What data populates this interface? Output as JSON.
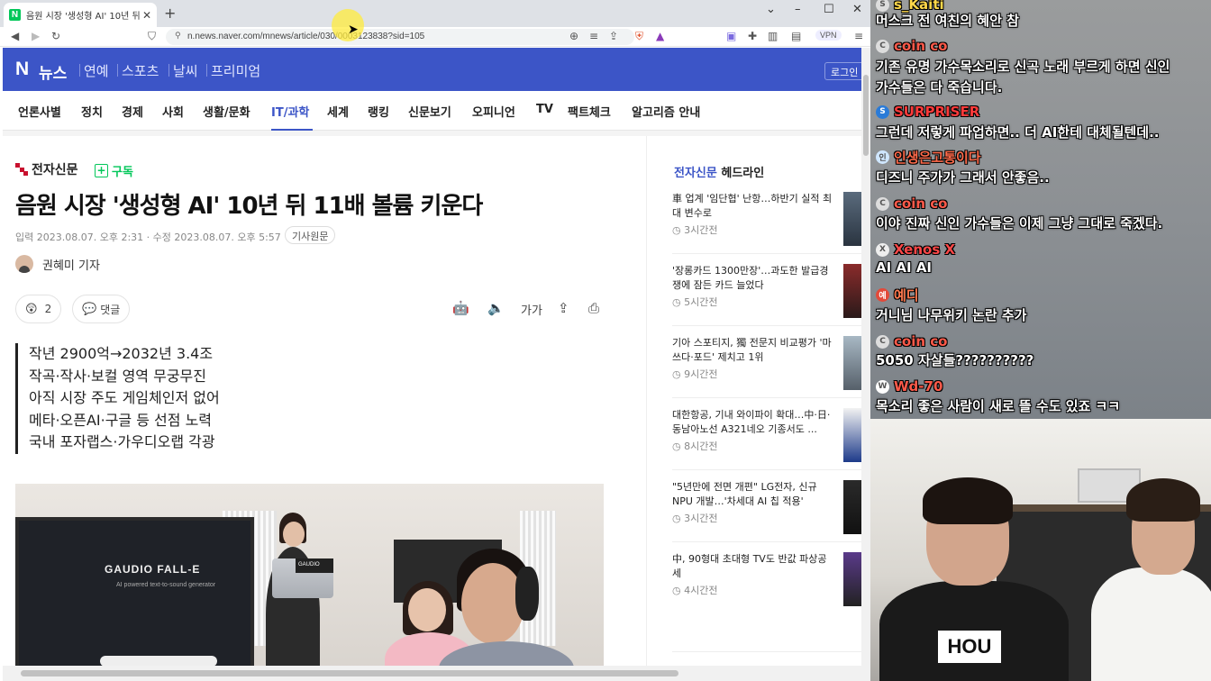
{
  "browser": {
    "tab_title": "음원 시장 '생성형 AI' 10년 뒤 11배 ...",
    "favicon_letter": "N",
    "url": "n.news.naver.com/mnews/article/030/0003123838?sid=105",
    "vpn_label": "VPN"
  },
  "naver": {
    "logo": "N",
    "news": "뉴스",
    "links": [
      "연예",
      "스포츠",
      "날씨",
      "프리미엄"
    ],
    "login": "로그인"
  },
  "menu": [
    "언론사별",
    "정치",
    "경제",
    "사회",
    "생활/문화",
    "IT/과학",
    "세계",
    "랭킹",
    "신문보기",
    "오피니언",
    "TV",
    "팩트체크",
    "알고리즘 안내"
  ],
  "article": {
    "press": "전자신문",
    "subscribe": "구독",
    "title": "음원 시장 '생성형 AI' 10년 뒤 11배 볼륨 키운다",
    "meta": "입력 2023.08.07. 오후 2:31 · 수정 2023.08.07. 오후 5:57",
    "original_button": "기사원문",
    "reporter": "권혜미 기자",
    "reaction_count": "2",
    "comment_label": "댓글",
    "font_size_label": "가가",
    "summary": [
      "작년 2900억→2032년 3.4조",
      "작곡·작사·보컬 영역 무궁무진",
      "아직 시장 주도 게임체인저 없어",
      "메타·오픈AI·구글 등 선점 노력",
      "국내 포자랩스·가우디오랩 각광"
    ],
    "photo_brand": "GAUDIO FALL-E",
    "photo_sub": "AI powered text-to-sound generator",
    "laptop_label": "GAUDIO"
  },
  "sidebar": {
    "press": "전자신문",
    "title": "헤드라인",
    "items": [
      {
        "text": "車 업계 '임단협' 난항…하반기 실적 최대 변수로",
        "time": "3시간전"
      },
      {
        "text": "'장롱카드 1300만장'…과도한 발급경쟁에 잠든 카드 늘었다",
        "time": "5시간전"
      },
      {
        "text": "기아 스포티지, 獨 전문지 비교평가 '마쓰다·포드' 제치고 1위",
        "time": "9시간전"
      },
      {
        "text": "대한항공, 기내 와이파이 확대…中·日·동남아노선 A321네오 기종서도 ...",
        "time": "8시간전"
      },
      {
        "text": "\"5년만에 전면 개편\" LG전자, 신규 NPU 개발…'차세대 AI 칩 적용'",
        "time": "3시간전"
      },
      {
        "text": "中, 90형대 초대형 TV도 반값 파상공세",
        "time": "4시간전"
      }
    ]
  },
  "chat": [
    {
      "name": "s_Kaiti",
      "msg": "머스크 전 여친의 혜안 참",
      "color": "#ffd84a",
      "icon": "S"
    },
    {
      "name": "coin co",
      "msg": "기존 유명 가수목소리로 신곡 노래 부르게 하면 신인",
      "msg2": "가수들은 다 죽습니다.",
      "color": "#ff5a4a",
      "icon": "C"
    },
    {
      "name": "SURPRISER",
      "msg": "그런데 저렇게 파업하면.. 더 AI한테 대체될텐데..",
      "color": "#ff3b3b",
      "icon": "S"
    },
    {
      "name": "인생은고통이다",
      "msg": "디즈니 주가가 그래서 안좋음..",
      "color": "#ff6a4a",
      "icon": "인"
    },
    {
      "name": "coin co",
      "msg": "이야 진짜 신인 가수들은 이제 그냥 그대로 죽겠다.",
      "color": "#ff5a4a",
      "icon": "C"
    },
    {
      "name": "Xenos X",
      "msg": "AI AI AI",
      "color": "#ff4848",
      "icon": "X"
    },
    {
      "name": "예디",
      "msg": "거니님 나무위키 논란 추가",
      "color": "#ff7a50",
      "icon": "예"
    },
    {
      "name": "coin co",
      "msg": "5050 자살들??????????",
      "color": "#ff5a4a",
      "icon": "C"
    },
    {
      "name": "Wd-70",
      "msg": "목소리 좋은 사람이 새로 뜰 수도 있죠 ㅋㅋ",
      "color": "#ff5a4a",
      "icon": "W"
    }
  ],
  "cam": {
    "shirt_text": "HOU"
  }
}
